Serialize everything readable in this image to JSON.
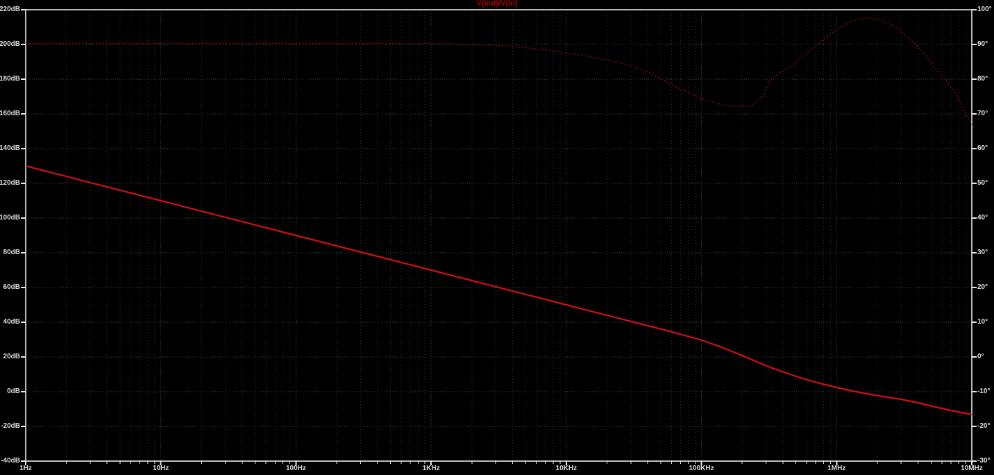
{
  "title": "V(out)/V(in)",
  "colors": {
    "background": "#000000",
    "frame": "#bcbcbc",
    "grid_major": "#3f3f3f",
    "grid_minor": "#323232",
    "tick": "#e8e8e8",
    "label_text": "#dcdcdc",
    "title_text": "#b00000",
    "magnitude_trace": "#d01010",
    "phase_trace": "#8f0a0a"
  },
  "chart_data": {
    "type": "line",
    "title": "V(out)/V(in)",
    "x_axis": {
      "scale": "log",
      "unit": "Hz",
      "min": 1,
      "max": 10000000,
      "decades": 7,
      "tick_labels": [
        "1Hz",
        "10Hz",
        "100Hz",
        "1KHz",
        "10KHz",
        "100KHz",
        "1MHz",
        "10MHz"
      ]
    },
    "y_left_axis": {
      "unit": "dB",
      "min": -40,
      "max": 220,
      "step": 20,
      "series_for": "magnitude",
      "tick_labels": [
        "220dB",
        "200dB",
        "180dB",
        "160dB",
        "140dB",
        "120dB",
        "100dB",
        "80dB",
        "60dB",
        "40dB",
        "20dB",
        "0dB",
        "-20dB",
        "-40dB"
      ]
    },
    "y_right_axis": {
      "unit": "deg",
      "min": -30,
      "max": 100,
      "step": 10,
      "series_for": "phase",
      "tick_labels": [
        "100°",
        "90°",
        "80°",
        "70°",
        "60°",
        "50°",
        "40°",
        "30°",
        "20°",
        "10°",
        "0°",
        "-10°",
        "-20°",
        "-30°"
      ]
    },
    "grid": true,
    "legend": "none",
    "series": [
      {
        "name": "magnitude",
        "axis": "left",
        "style": "solid",
        "slope_low_freq": "-20dB/decade",
        "points": [
          [
            1,
            130
          ],
          [
            10,
            110
          ],
          [
            100,
            90
          ],
          [
            1000,
            70
          ],
          [
            10000,
            50
          ],
          [
            30000,
            40.5
          ],
          [
            60000,
            34.5
          ],
          [
            100000,
            29.7
          ],
          [
            130000,
            26.6
          ],
          [
            160000,
            23.9
          ],
          [
            200000,
            20.8
          ],
          [
            260000,
            17.0
          ],
          [
            330000,
            13.7
          ],
          [
            430000,
            10.6
          ],
          [
            550000,
            7.8
          ],
          [
            700000,
            5.4
          ],
          [
            900000,
            3.3
          ],
          [
            1200000,
            1.0
          ],
          [
            1600000,
            -0.9
          ],
          [
            2200000,
            -2.8
          ],
          [
            3000000,
            -4.4
          ],
          [
            4000000,
            -6.4
          ],
          [
            5000000,
            -8.3
          ],
          [
            7000000,
            -10.8
          ],
          [
            10000000,
            -13.2
          ]
        ]
      },
      {
        "name": "phase",
        "axis": "right",
        "style": "dotted",
        "points": [
          [
            1,
            90.3
          ],
          [
            10,
            90.3
          ],
          [
            100,
            90.3
          ],
          [
            500,
            90.3
          ],
          [
            1000,
            90.2
          ],
          [
            2000,
            90.0
          ],
          [
            3000,
            89.8
          ],
          [
            5000,
            89.1
          ],
          [
            8000,
            88.1
          ],
          [
            13000,
            86.9
          ],
          [
            20000,
            85.5
          ],
          [
            30000,
            83.9
          ],
          [
            40000,
            82.0
          ],
          [
            50000,
            80.1
          ],
          [
            70000,
            77.2
          ],
          [
            100000,
            74.4
          ],
          [
            130000,
            73.0
          ],
          [
            160000,
            72.3
          ],
          [
            200000,
            72.1
          ],
          [
            240000,
            72.6
          ],
          [
            280000,
            74.8
          ],
          [
            326000,
            80.0
          ],
          [
            380000,
            81.8
          ],
          [
            430000,
            83.0
          ],
          [
            550000,
            86.0
          ],
          [
            650000,
            88.5
          ],
          [
            730000,
            90.2
          ],
          [
            850000,
            92.3
          ],
          [
            1000000,
            94.3
          ],
          [
            1300000,
            96.8
          ],
          [
            1650000,
            97.7
          ],
          [
            2000000,
            97.2
          ],
          [
            2500000,
            95.8
          ],
          [
            3000000,
            93.8
          ],
          [
            3800000,
            90.2
          ],
          [
            4500000,
            87.2
          ],
          [
            5100000,
            84.2
          ],
          [
            6300000,
            80.0
          ],
          [
            7900000,
            74.8
          ],
          [
            9200000,
            69.3
          ],
          [
            10000000,
            66.9
          ]
        ]
      }
    ]
  }
}
